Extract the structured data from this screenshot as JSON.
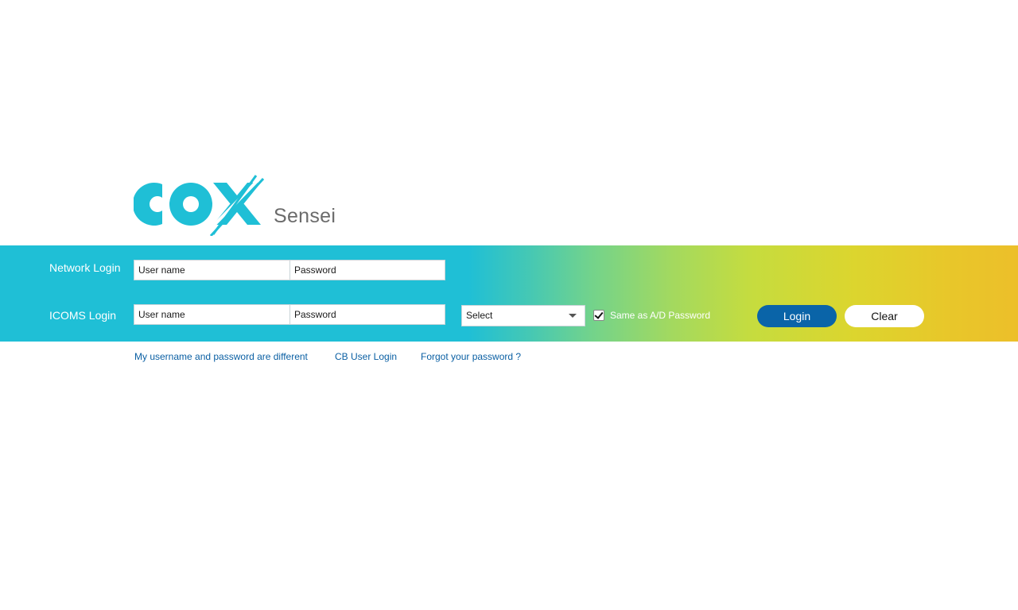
{
  "brand": {
    "logo_text": "COX",
    "product_name": "Sensei",
    "colors": {
      "logo": "#1fbfd6",
      "band_start": "#1fbfd6",
      "band_end": "#ecbf2a",
      "login_button": "#0a64a8",
      "link": "#0a5fa3"
    }
  },
  "network_login": {
    "label": "Network Login",
    "username_placeholder": "User name",
    "password_placeholder": "Password"
  },
  "icoms_login": {
    "label": "ICOMS Login",
    "username_placeholder": "User name",
    "password_placeholder": "Password",
    "select_value": "Select",
    "same_as_checkbox": {
      "label": "Same as A/D Password",
      "checked": true
    }
  },
  "buttons": {
    "login": "Login",
    "clear": "Clear"
  },
  "links": [
    {
      "label": "My username and password are different"
    },
    {
      "label": "CB User Login"
    },
    {
      "label": "Forgot your password ?"
    }
  ],
  "icons": {
    "select_caret": "chevron-down-icon",
    "checkbox_tick": "checkmark-icon"
  }
}
